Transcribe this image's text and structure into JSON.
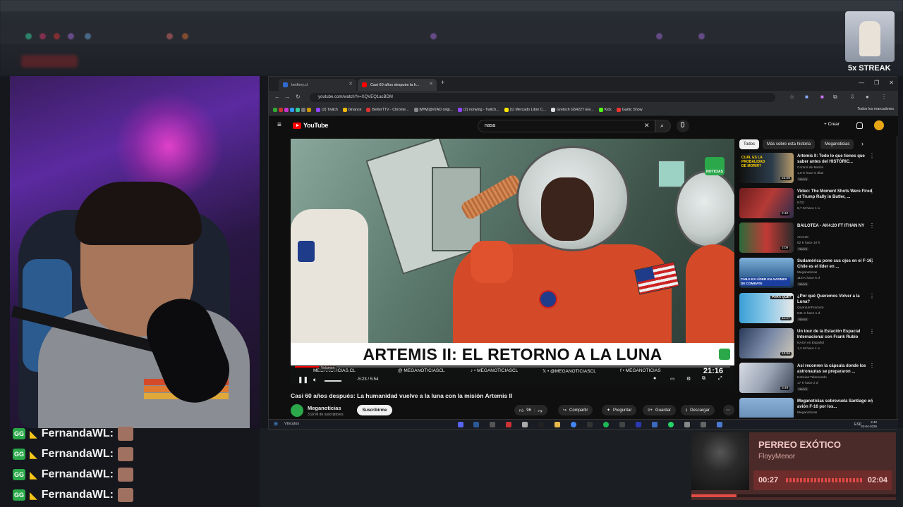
{
  "streak": {
    "text": "5x STREAK"
  },
  "chat": [
    {
      "user": "FernandaWL:",
      "badge": "GG"
    },
    {
      "user": "FernandaWL:",
      "badge": "GG"
    },
    {
      "user": "FernandaWL:",
      "badge": "GG"
    },
    {
      "user": "FernandaWL:",
      "badge": "GG"
    }
  ],
  "browser": {
    "tabs": [
      {
        "label": "betfiery.cl"
      },
      {
        "label": "Casi 60 años después la h..."
      }
    ],
    "url": "youtube.com/watch?v=XQVEQ1acBDM",
    "bookmarks": [
      "(2) Twitch",
      "binance",
      "BetterTTV - Chrome...",
      "[WW]@#2AD origi...",
      "(2) norwing - Twitch...",
      "(1) Mercado Libre C...",
      "Gretsch G5422T Ele...",
      "Kick",
      "Gartic Show"
    ],
    "all_bookmarks": "Todos los marcadores"
  },
  "youtube": {
    "logo": "YouTube",
    "search_value": "nasa",
    "create_label": "+ Crear",
    "video": {
      "lower_title": "ARTEMIS II: EL RETORNO A LA LUNA",
      "noticias_label": "NOTICIAS",
      "social": [
        "MEGANOTICIAS.CL",
        "@ MEGANOTICIASCL",
        "♪ • MEGANOTICIASCL",
        "𝕏 • @MEGANOTICIASCL",
        "f • MEGANOTICIAS"
      ],
      "clock": "21:16",
      "volume_label": "Volumen",
      "time": "-5:23 / 5:54",
      "progress": 0.09
    },
    "title": "Casi 60 años después: La humanidad vuelve a la luna con la misión Artemis II",
    "channel": {
      "name": "Meganoticias",
      "subs": "3,92 M de suscriptores",
      "subscribe": "Suscribirme"
    },
    "actions": {
      "likes": "96",
      "share": "Compartir",
      "ask": "Preguntar",
      "save": "Guardar",
      "download": "Descargar"
    },
    "chips": [
      "Todos",
      "Más sobre esta historia",
      "Meganoticias"
    ],
    "recs": [
      {
        "title": "Artemis II: Todo lo que tienes que saber antes del HISTÓRIC...",
        "channel": "Control de Misión",
        "meta": "1,9 K  hace 6 días",
        "badge": "Nuevo",
        "duration": "22:06"
      },
      {
        "title": "Video: The Moment Shots Were Fired at Trump Rally in Butler, ...",
        "channel": "NTD",
        "meta": "8,7 M  hace 1 a",
        "badge": "",
        "duration": "2:40"
      },
      {
        "title": "BAILOTEA - AK4:20 FT ITHAN NY",
        "channel": "AK4:20",
        "meta": "62 K  hace 10 h",
        "badge": "Nuevo",
        "duration": "2:09"
      },
      {
        "title": "Sudamérica pone sus ojos en el F-16: Chile es el líder en ...",
        "channel": "Meganoticias",
        "meta": "116 K  hace 5 d",
        "badge": "Nuevo",
        "duration": ""
      },
      {
        "title": "¿Por qué Queremos Volver a la Luna?",
        "channel": "QuantumFracture",
        "meta": "541 K  hace 1 d",
        "badge": "Nuevo",
        "duration": "11:47"
      },
      {
        "title": "Un tour de la Estación Espacial Internacional con Frank Rubio",
        "channel": "NASA en Español",
        "meta": "1,2 M  hace 1 a",
        "badge": "",
        "duration": "13:56"
      },
      {
        "title": "Así reconren la cápsula donde los astronautas se prepararon ...",
        "channel": "Noticias Telemundo",
        "meta": "17 K  hace 2 d",
        "badge": "Nuevo",
        "duration": "3:49"
      },
      {
        "title": "Meganoticias sobrevuela Santiago en avión F-16 por los...",
        "channel": "Meganoticias",
        "meta": "",
        "badge": "",
        "duration": ""
      }
    ],
    "thumb_texts": {
      "r1": "CUÁL ES LA PROBALIDAD DE MORIR?",
      "r4": "CHILE ES LÍDER EN AVIONES DE COMBATE",
      "r5": "PARA QUÉ?"
    }
  },
  "taskbar": {
    "search": "Vínculos",
    "lang": "ESP",
    "time": "2:40",
    "date": "03-04-2026"
  },
  "music": {
    "title": "PERREO EXÓTICO",
    "artist": "FloyyMenor",
    "current": "00:27",
    "total": "02:04",
    "progress": 0.22
  }
}
